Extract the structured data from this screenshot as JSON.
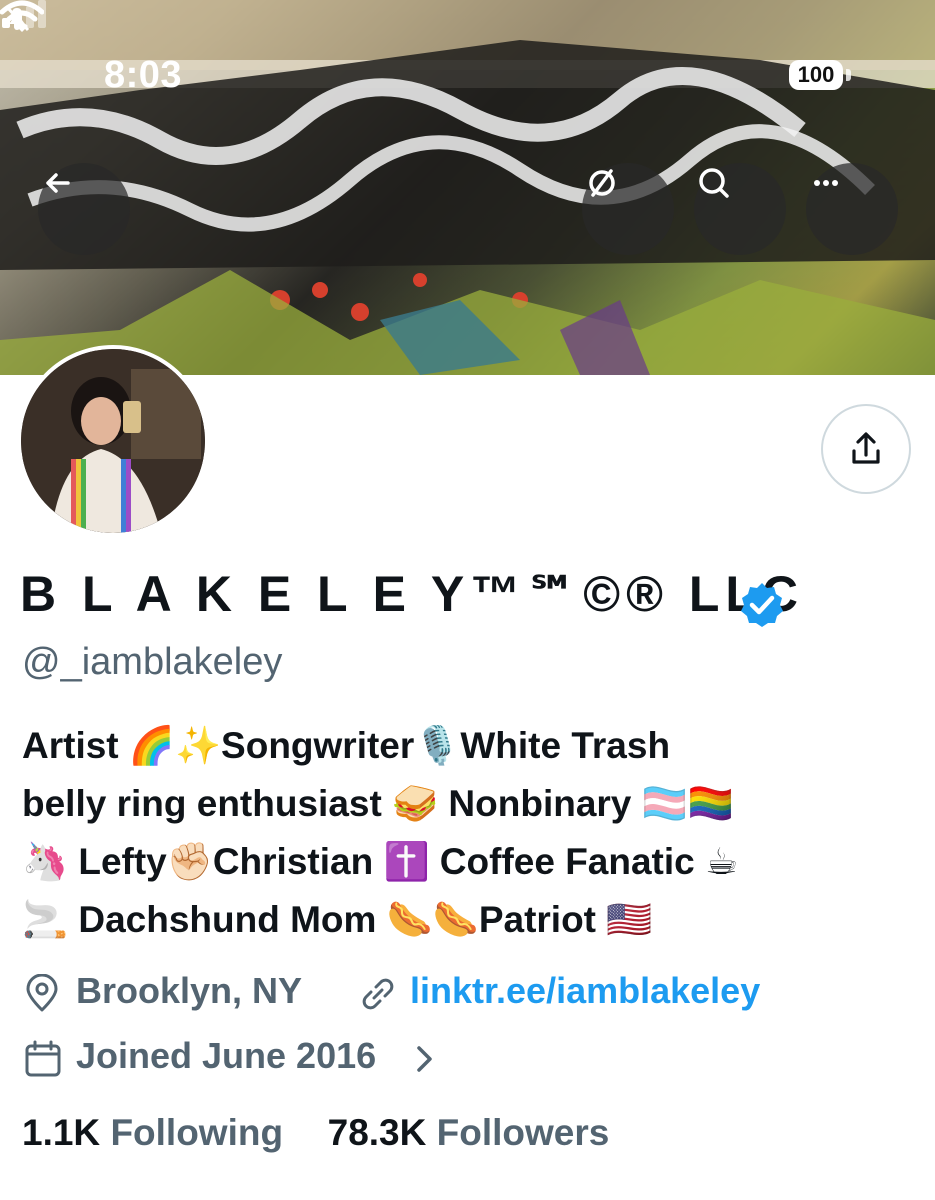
{
  "status_bar": {
    "time": "8:03",
    "battery": "100"
  },
  "header": {
    "back_icon": "arrow-left-icon",
    "grok_icon": "slash-circle-icon",
    "search_icon": "search-icon",
    "more_icon": "more-icon"
  },
  "profile": {
    "display_name": "B L A K E L E Y™℠©® LLC",
    "handle": "@_iamblakeley",
    "bio_lines": [
      "Artist 🌈✨Songwriter🎙️White Trash",
      "belly ring enthusiast 🥪 Nonbinary 🏳️‍⚧️🏳️‍🌈",
      "🦄 Lefty✊🏻Christian ✝️ Coffee Fanatic ☕",
      "🚬 Dachshund Mom 🌭🌭Patriot 🇺🇸"
    ],
    "location": "Brooklyn, NY",
    "link": "linktr.ee/iamblakeley",
    "joined": "Joined June 2016",
    "following_count": "1.1K",
    "following_label": "Following",
    "followers_count": "78.3K",
    "followers_label": "Followers"
  },
  "colors": {
    "accent": "#1d9bf0",
    "secondary_text": "#536471",
    "primary_text": "#0f1419"
  }
}
